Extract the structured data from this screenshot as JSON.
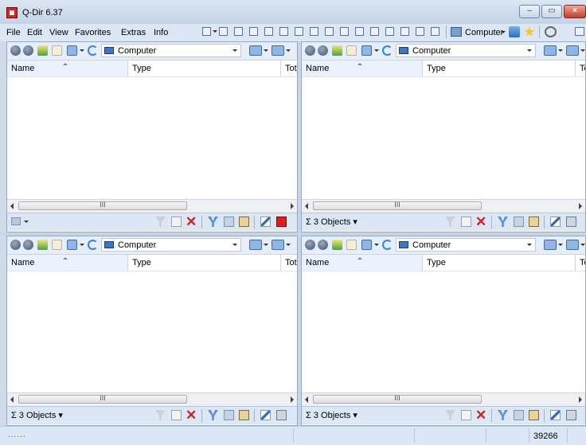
{
  "window": {
    "title": "Q-Dir 6.37"
  },
  "menu": [
    "File",
    "Edit",
    "View",
    "Favorites",
    "Extras",
    "Info"
  ],
  "toolbar": {
    "computer_label": "Computer"
  },
  "panes": [
    {
      "address": "Computer",
      "columns": [
        "Name",
        "Type",
        "Tot"
      ],
      "status": "",
      "scroll_mark": "III"
    },
    {
      "address": "Computer",
      "columns": [
        "Name",
        "Type",
        "Tot"
      ],
      "status": "Σ 3 Objects ▾",
      "scroll_mark": "III"
    },
    {
      "address": "Computer",
      "columns": [
        "Name",
        "Type",
        "Tot"
      ],
      "status": "Σ 3 Objects ▾",
      "scroll_mark": "III"
    },
    {
      "address": "Computer",
      "columns": [
        "Name",
        "Type",
        "Tot"
      ],
      "status": "Σ 3 Objects ▾",
      "scroll_mark": "III"
    }
  ],
  "bottom": {
    "left": "......",
    "number": "39266"
  },
  "colors": {
    "title_bg": "#c8d7ea",
    "pane_bar": "#e5eef9",
    "close_red": "#c53d2a"
  }
}
